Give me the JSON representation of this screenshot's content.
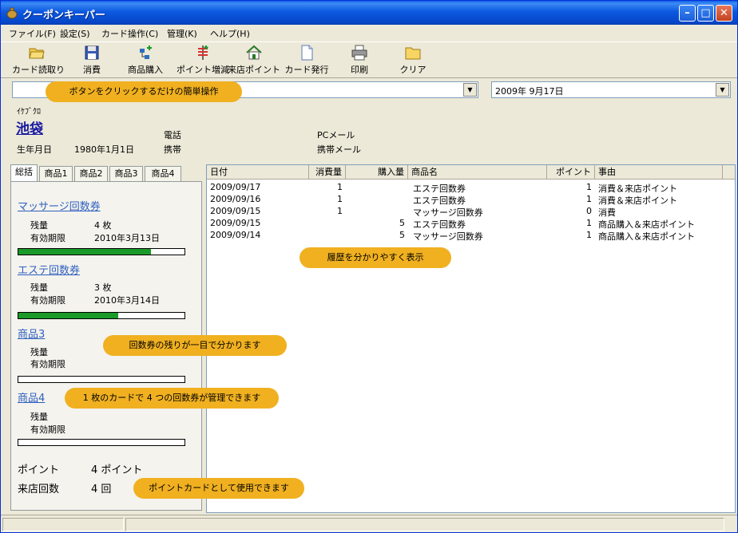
{
  "window": {
    "title": "クーポンキーパー"
  },
  "menu": [
    "ファイル(F)",
    "設定(S)",
    "カード操作(C)",
    "管理(K)",
    "ヘルプ(H)"
  ],
  "toolbar": [
    {
      "label": "カード読取り",
      "icon": "folder-open-icon"
    },
    {
      "label": "消費",
      "icon": "floppy-disk-icon"
    },
    {
      "label": "商品購入",
      "icon": "hierarchy-add-icon"
    },
    {
      "label": "ポイント増減",
      "icon": "plus-minus-icon"
    },
    {
      "label": "来店ポイント",
      "icon": "house-icon"
    },
    {
      "label": "カード発行",
      "icon": "document-icon"
    },
    {
      "label": "印刷",
      "icon": "printer-icon"
    },
    {
      "label": "クリア",
      "icon": "folder-icon"
    }
  ],
  "search_combo": {
    "value": ""
  },
  "date_combo": {
    "value": "2009年  9月17日"
  },
  "customer": {
    "kana": "ｲｹﾌﾞｸﾛ",
    "name": "池袋",
    "birth_label": "生年月日",
    "birth_value": "1980年1月1日",
    "phone_label": "電話",
    "mobile_label": "携帯",
    "pcmail_label": "PCメール",
    "mobilemail_label": "携帯メール"
  },
  "tabs": [
    "総括",
    "商品1",
    "商品2",
    "商品3",
    "商品4"
  ],
  "summary": {
    "coupons": [
      {
        "title": "マッサージ回数券",
        "remain_label": "残量",
        "remain": "4 枚",
        "expiry_label": "有効期限",
        "expiry": "2010年3月13日",
        "fill": 0.8
      },
      {
        "title": "エステ回数券",
        "remain_label": "残量",
        "remain": "3 枚",
        "expiry_label": "有効期限",
        "expiry": "2010年3月14日",
        "fill": 0.6
      },
      {
        "title": "商品3",
        "remain_label": "残量",
        "remain": "",
        "expiry_label": "有効期限",
        "expiry": "",
        "fill": 0
      },
      {
        "title": "商品4",
        "remain_label": "残量",
        "remain": "",
        "expiry_label": "有効期限",
        "expiry": "",
        "fill": 0
      }
    ],
    "points_label": "ポイント",
    "points_value": "4 ポイント",
    "visits_label": "来店回数",
    "visits_value": "4 回"
  },
  "history": {
    "columns": [
      "日付",
      "消費量",
      "購入量",
      "商品名",
      "ポイント",
      "事由"
    ],
    "rows": [
      [
        "2009/09/17",
        "1",
        "",
        "エステ回数券",
        "1",
        "消費＆来店ポイント"
      ],
      [
        "2009/09/16",
        "1",
        "",
        "エステ回数券",
        "1",
        "消費＆来店ポイント"
      ],
      [
        "2009/09/15",
        "1",
        "",
        "マッサージ回数券",
        "0",
        "消費"
      ],
      [
        "2009/09/15",
        "",
        "5",
        "エステ回数券",
        "1",
        "商品購入＆来店ポイント"
      ],
      [
        "2009/09/14",
        "",
        "5",
        "マッサージ回数券",
        "1",
        "商品購入＆来店ポイント"
      ]
    ]
  },
  "callouts": {
    "c1": "ボタンをクリックするだけの簡単操作",
    "c2": "履歴を分かりやすく表示",
    "c3": "回数券の残りが一目で分かります",
    "c4": "1 枚のカードで 4 つの回数券が管理できます",
    "c5": "ポイントカードとして使用できます"
  },
  "colors": {
    "accent": "#0a5fe6",
    "callout": "#f0b020",
    "bar_fill": "#1a9a28"
  }
}
